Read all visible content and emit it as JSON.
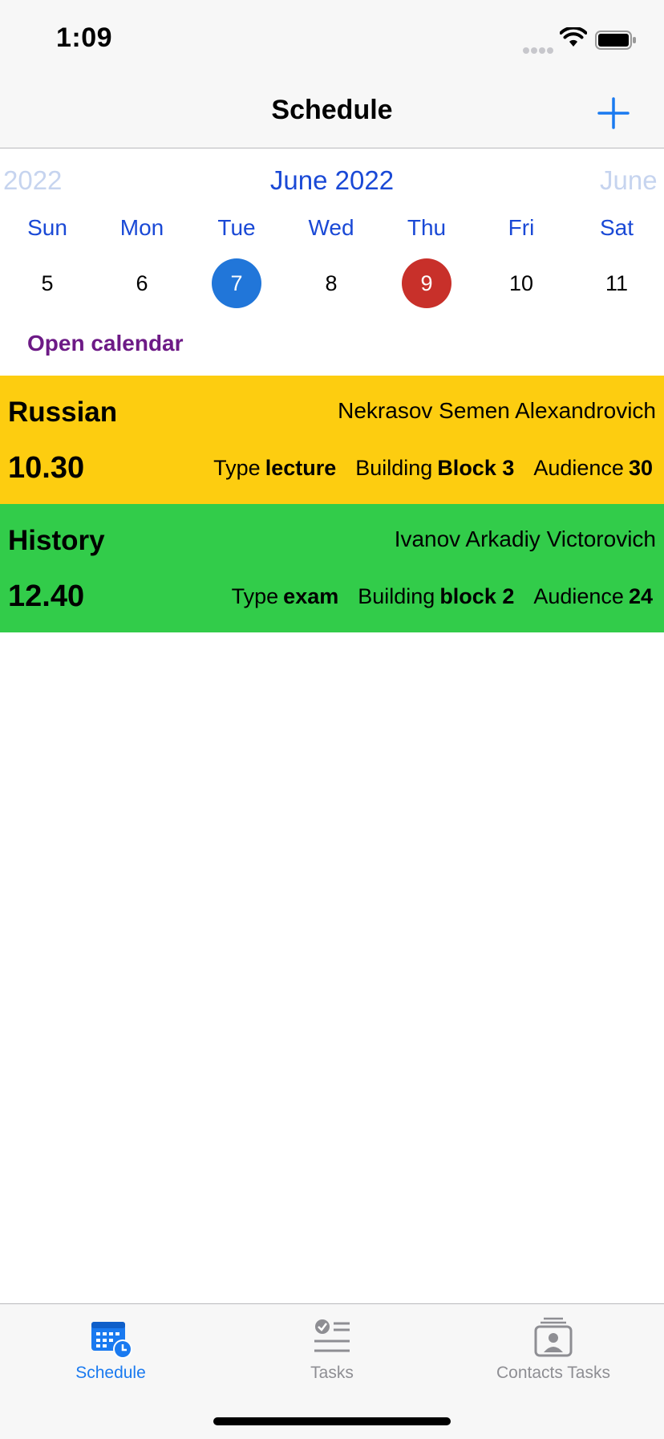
{
  "status_bar": {
    "time": "1:09"
  },
  "nav": {
    "title": "Schedule",
    "add_icon": "plus-icon"
  },
  "month_strip": {
    "prev": "2022",
    "current": "June 2022",
    "next": "June"
  },
  "week": {
    "days": [
      "Sun",
      "Mon",
      "Tue",
      "Wed",
      "Thu",
      "Fri",
      "Sat"
    ],
    "dates": [
      "5",
      "6",
      "7",
      "8",
      "9",
      "10",
      "11"
    ],
    "selected_index": 2,
    "today_index": 4
  },
  "open_calendar": "Open calendar",
  "lessons": [
    {
      "subject": "Russian",
      "teacher": "Nekrasov Semen Alexandrovich",
      "time": "10.30",
      "type_label": "Type",
      "type_value": "lecture",
      "building_label": "Building",
      "building_value": "Block 3",
      "audience_label": "Audience",
      "audience_value": "30",
      "color": "#fdcd10"
    },
    {
      "subject": "History",
      "teacher": "Ivanov Arkadiy Victorovich",
      "time": "12.40",
      "type_label": "Type",
      "type_value": "exam",
      "building_label": "Building",
      "building_value": "block 2",
      "audience_label": "Audience",
      "audience_value": "24",
      "color": "#32cc4a"
    }
  ],
  "tabs": [
    {
      "label": "Schedule",
      "icon": "calendar-clock-icon",
      "active": true
    },
    {
      "label": "Tasks",
      "icon": "checklist-icon",
      "active": false
    },
    {
      "label": "Contacts Tasks",
      "icon": "contact-card-icon",
      "active": false
    }
  ],
  "colors": {
    "accent": "#1a7af0",
    "calendar_text": "#1a49d6",
    "selected_date": "#2176d9",
    "today_date": "#c8302a",
    "open_calendar": "#6d1a86"
  }
}
